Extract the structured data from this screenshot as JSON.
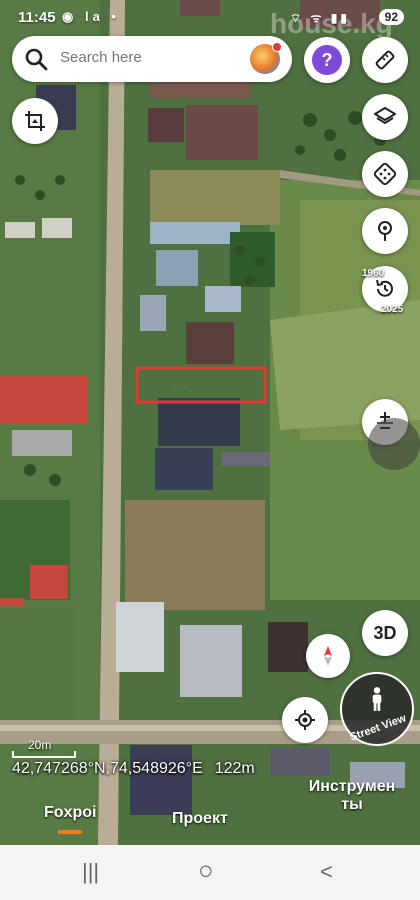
{
  "status_bar": {
    "time": "11:45",
    "left_icons": "◉ la •",
    "right_icons": "⌔ ᯤ ▮▮",
    "battery": "92"
  },
  "search": {
    "placeholder": "Search here"
  },
  "watermark": "house.kg",
  "timeline": {
    "start_year": "1960",
    "end_year": "2025"
  },
  "zoom_control": {
    "label": "+\n−"
  },
  "view_3d": {
    "label": "3D"
  },
  "street_view": {
    "label": "Street View"
  },
  "scale": {
    "label": "20m"
  },
  "coordinates": {
    "text": "42,747268°N,74,548926°E",
    "altitude": "122m"
  },
  "bottom_tabs": {
    "tab1": "Foxpoi",
    "tab2": "Проект",
    "tab3_line1": "Инструмен",
    "tab3_line2": "ты"
  },
  "navbar": {
    "recent": "|||",
    "home": "○",
    "back": "<"
  },
  "colors": {
    "highlight": "#e53935",
    "accent": "#ff7a1a",
    "help": "#7b4bd8"
  },
  "icons": [
    "search-icon",
    "avatar",
    "help-icon",
    "ruler-icon",
    "crop-icon",
    "layers-icon",
    "dice-icon",
    "pin-icon",
    "history-icon",
    "zoom-icon",
    "compass-icon",
    "location-icon",
    "pegman-icon"
  ]
}
